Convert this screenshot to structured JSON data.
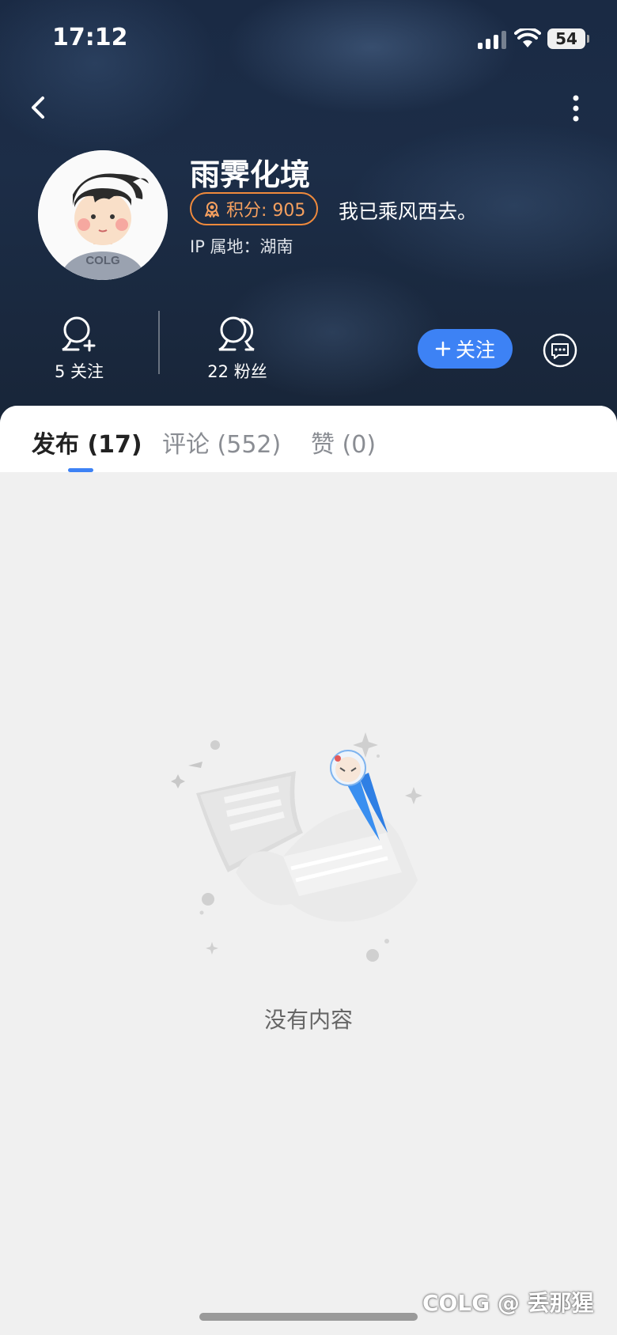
{
  "status_bar": {
    "time": "17:12",
    "battery": "54"
  },
  "profile": {
    "username": "雨霁化境",
    "points_label": "积分: 905",
    "signature": "我已乘风西去。",
    "ip_location": "IP 属地：湖南",
    "avatar_text": "COLG"
  },
  "stats": {
    "following_label": "5 关注",
    "fans_label": "22 粉丝"
  },
  "actions": {
    "follow_label": "关注"
  },
  "tabs": [
    {
      "label": "发布 (17)",
      "active": true
    },
    {
      "label": "评论 (552)",
      "active": false
    },
    {
      "label": "赞 (0)",
      "active": false
    }
  ],
  "empty_state": {
    "text": "没有内容"
  },
  "watermark": "COLG @ 丢那猩",
  "colors": {
    "accent": "#3d82f5",
    "points": "#f08a3c",
    "header_bg": "#1c2d47"
  },
  "icons": [
    "back-icon",
    "more-icon",
    "medal-icon",
    "follow-user-icon",
    "fans-icon",
    "plus-icon",
    "chat-icon",
    "signal-icon",
    "wifi-icon"
  ]
}
